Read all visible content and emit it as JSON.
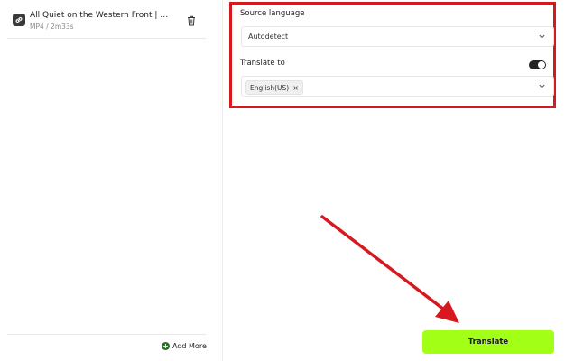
{
  "file": {
    "title": "All Quiet on the Western Front | Offici...",
    "meta": "MP4 / 2m33s",
    "icon": "link-icon"
  },
  "sidebar": {
    "add_more_label": "Add More"
  },
  "settings": {
    "source_language_label": "Source language",
    "source_language_value": "Autodetect",
    "translate_to_label": "Translate to",
    "translate_to_toggle_on": true,
    "target_language_chip": "English(US)"
  },
  "actions": {
    "translate_label": "Translate"
  },
  "colors": {
    "accent": "#a2ff16",
    "annotation": "#d6191f"
  }
}
